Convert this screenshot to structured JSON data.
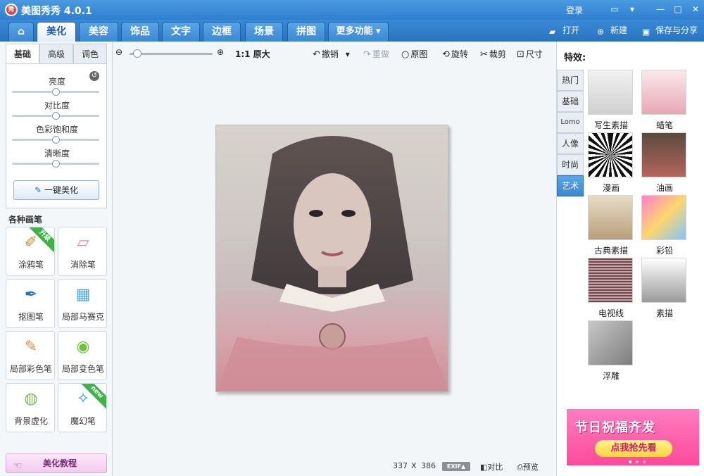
{
  "window": {
    "title": "美图秀秀 4.0.1",
    "logo_text": "秀",
    "login": "登录"
  },
  "tabs": [
    {
      "label": "美化",
      "active": true
    },
    {
      "label": "美容"
    },
    {
      "label": "饰品"
    },
    {
      "label": "文字"
    },
    {
      "label": "边框"
    },
    {
      "label": "场景"
    },
    {
      "label": "拼图"
    },
    {
      "label": "更多功能 ▾"
    }
  ],
  "top_actions": {
    "open": "打开",
    "new": "新建",
    "save_share": "保存与分享"
  },
  "left": {
    "subtabs": [
      "基础",
      "高级",
      "调色"
    ],
    "sliders": [
      {
        "label": "亮度",
        "value": 0.5
      },
      {
        "label": "对比度",
        "value": 0.5
      },
      {
        "label": "色彩饱和度",
        "value": 0.5
      },
      {
        "label": "清晰度",
        "value": 0.5
      }
    ],
    "one_click": "一键美化",
    "brushes_title": "各种画笔",
    "brushes": [
      {
        "label": "涂鸦笔",
        "icon": "paintbrush-icon",
        "badge": "升级"
      },
      {
        "label": "消除笔",
        "icon": "eraser-icon"
      },
      {
        "label": "抠图笔",
        "icon": "cutout-pen-icon"
      },
      {
        "label": "局部马赛克",
        "icon": "mosaic-icon"
      },
      {
        "label": "局部彩色笔",
        "icon": "color-brush-icon"
      },
      {
        "label": "局部变色笔",
        "icon": "paint-bucket-icon"
      },
      {
        "label": "背景虚化",
        "icon": "blur-icon"
      },
      {
        "label": "魔幻笔",
        "icon": "magic-pen-icon",
        "badge": "new"
      }
    ],
    "tutorial": "美化教程"
  },
  "toolbar": {
    "original_size": "1:1 原大",
    "undo": "撤销",
    "redo": "重做",
    "original": "原图",
    "rotate": "旋转",
    "crop": "裁剪",
    "size": "尺寸",
    "zoom_level": 0.05
  },
  "status": {
    "width": "337",
    "x": "X",
    "height": "386",
    "exif": "EXIF▲",
    "compare": "对比",
    "preview": "预览"
  },
  "right": {
    "title": "特效:",
    "categories": [
      {
        "label": "热门"
      },
      {
        "label": "基础"
      },
      {
        "label": "Lomo"
      },
      {
        "label": "人像"
      },
      {
        "label": "时尚"
      },
      {
        "label": "艺术",
        "active": true
      }
    ],
    "effects": [
      {
        "label": "写生素描"
      },
      {
        "label": "蜡笔"
      },
      {
        "label": "漫画"
      },
      {
        "label": "油画"
      },
      {
        "label": "古典素描"
      },
      {
        "label": "彩铅"
      },
      {
        "label": "电视线"
      },
      {
        "label": "素描"
      },
      {
        "label": "浮雕"
      }
    ],
    "ad": {
      "headline": "节日祝福齐发",
      "button": "点我抢先看"
    }
  },
  "colors": {
    "title_bar": "#2f7fd0",
    "active_category": "#3b87d3",
    "ad_pink": "#ff4a9a"
  }
}
